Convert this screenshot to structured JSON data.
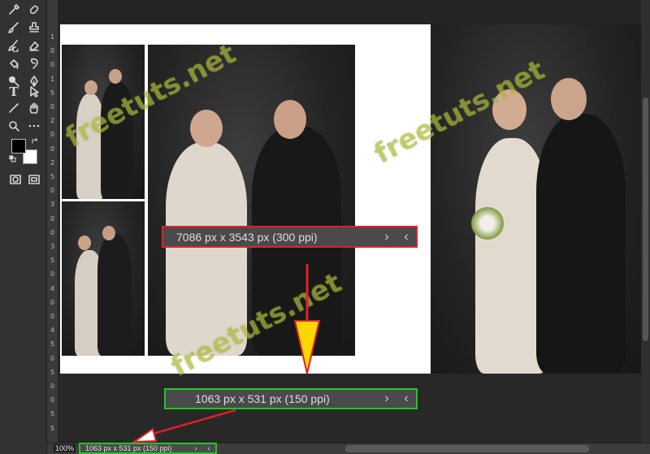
{
  "statusbar": {
    "large": {
      "info": "7086 px x 3543 px (300 ppi)",
      "next": "›",
      "prev": "‹"
    },
    "medium": {
      "info": "1063 px x 531 px (150 ppi)",
      "next": "›",
      "prev": "‹"
    },
    "bottom": {
      "info": "1063 px x 531 px (150 ppi)",
      "next": "›",
      "prev": "‹"
    }
  },
  "zoom": "100%",
  "watermark": "freetuts.net",
  "ruler": {
    "labels": [
      "1",
      "0",
      "0",
      "1",
      "5",
      "0",
      "2",
      "0",
      "0",
      "2",
      "5",
      "0",
      "3",
      "0",
      "0",
      "3",
      "5",
      "0",
      "4",
      "0",
      "0",
      "4",
      "5",
      "0",
      "5",
      "0",
      "0",
      "5",
      "5"
    ]
  },
  "toolbar": {
    "foreground_color": "#000000",
    "background_color": "#ffffff",
    "text_tool": "T"
  },
  "colors": {
    "highlight_red": "#e0202a",
    "highlight_green": "#25c425",
    "arrow_yellow": "#f7d800"
  }
}
